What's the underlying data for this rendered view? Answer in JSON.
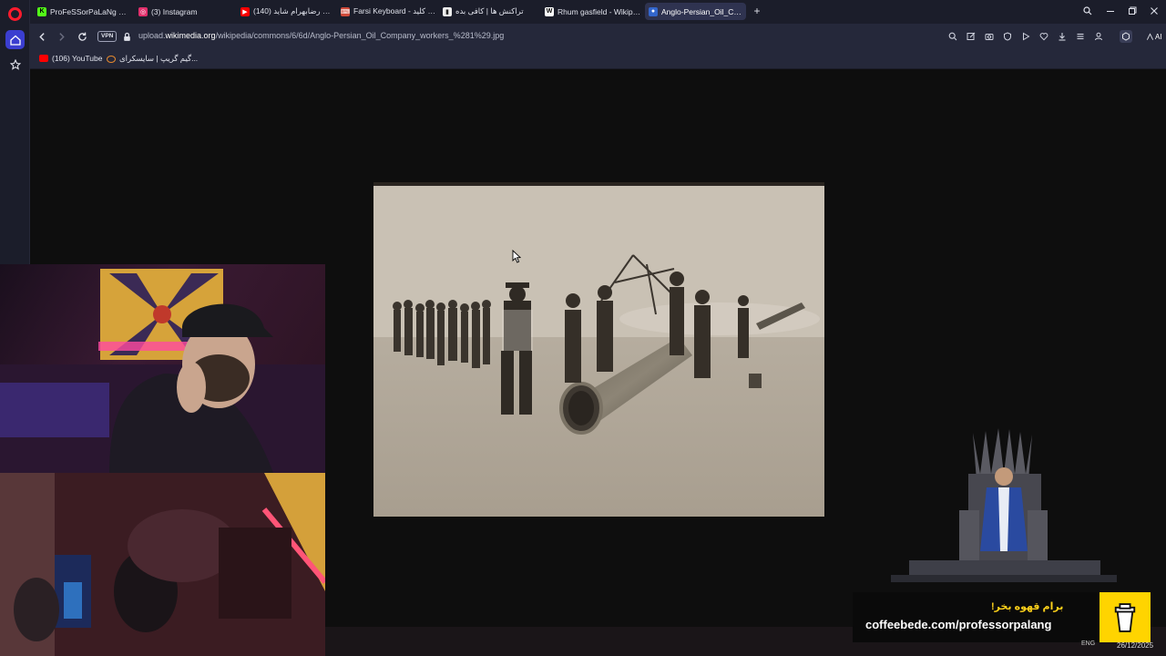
{
  "browser": {
    "tabs": [
      {
        "title": "ProFeSSorPaLaNg Stream",
        "icon": "kick-icon",
        "color": "#53fc18",
        "active": false
      },
      {
        "title": "(3) Instagram",
        "icon": "instagram-icon",
        "color": "#e1306c",
        "active": false
      },
      {
        "title": "(140) آهنگ رضابهرام شاید",
        "icon": "youtube-icon",
        "color": "#ff0000",
        "active": false
      },
      {
        "title": "Farsi Keyboard - صفحه کلید",
        "icon": "keyboard-icon",
        "color": "#d04a3a",
        "active": false
      },
      {
        "title": "تراکنش ها | کافی بده",
        "icon": "coffee-icon",
        "color": "#eeeeee",
        "active": false
      },
      {
        "title": "Rhum gasfield - Wikipedia",
        "icon": "wikipedia-icon",
        "color": "#ffffff",
        "active": false
      },
      {
        "title": "Anglo-Persian_Oil_Compa",
        "icon": "wikimedia-icon",
        "color": "#3366cc",
        "active": true
      }
    ],
    "url_prefix": "upload.",
    "url_host": "wikimedia.org",
    "url_path": "/wikipedia/commons/6/6d/Anglo-Persian_Oil_Company_workers_%281%29.jpg",
    "vpn_label": "VPN",
    "ai_label": "AI",
    "bookmarks": [
      {
        "label": "(106) YouTube",
        "icon": "youtube-icon"
      },
      {
        "label": "گیم گریپ | سایسکرای...",
        "icon": "site-icon"
      }
    ]
  },
  "overlay": {
    "donation_fa": "برام قهوه بخر!",
    "donation_url": "coffeebede.com/professorpalang",
    "date": "26/12/2025",
    "lang": "ENG"
  },
  "colors": {
    "accent": "#3b3ed0",
    "opera_red": "#ff1b2d",
    "donation_yellow": "#ffd400"
  }
}
